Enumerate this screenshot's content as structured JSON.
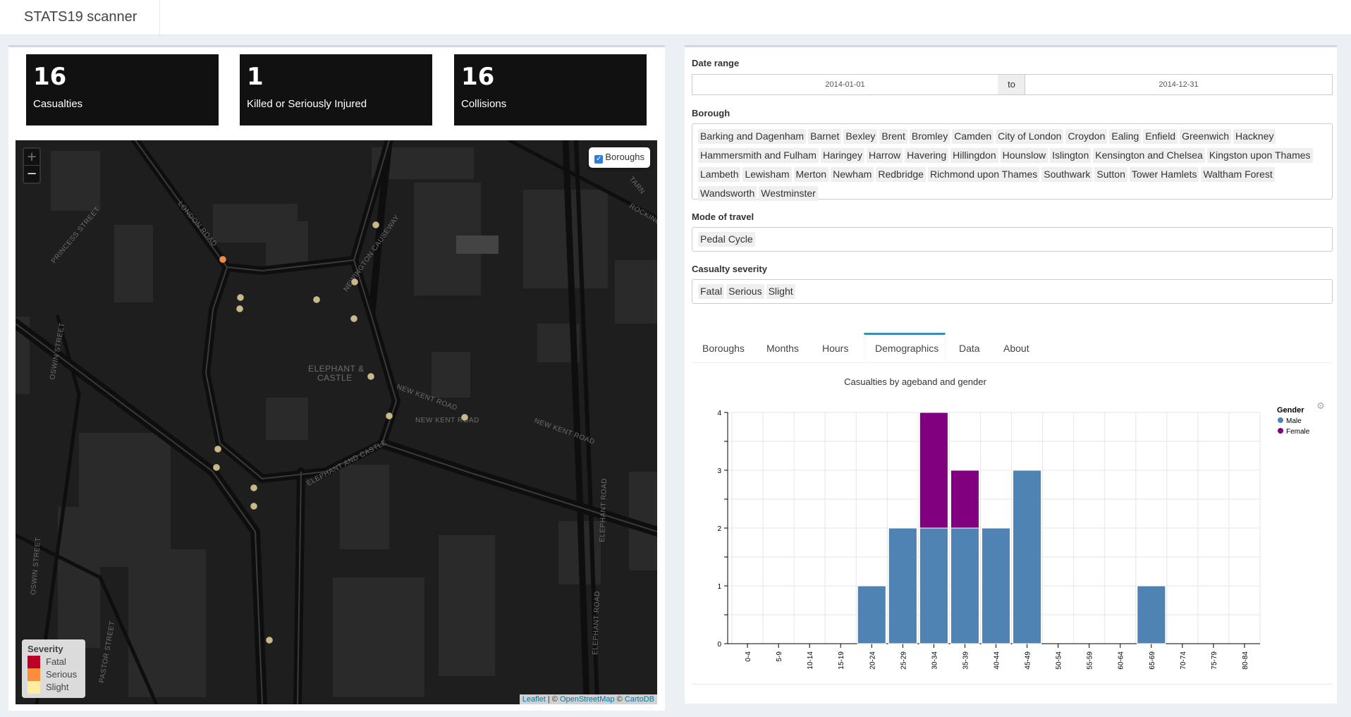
{
  "app": {
    "title": "STATS19 scanner"
  },
  "value_boxes": [
    {
      "value": "16",
      "label": "Casualties"
    },
    {
      "value": "1",
      "label": "Killed or Seriously Injured"
    },
    {
      "value": "16",
      "label": "Collisions"
    }
  ],
  "map": {
    "zoom_in": "+",
    "zoom_out": "−",
    "layers_control": {
      "label": "Boroughs",
      "checked": true
    },
    "labels": [
      "LONDON ROAD",
      "PRINCESS STREET",
      "NEWINGTON CAUSEWAY",
      "ELEPHANT &",
      "CASTLE",
      "NEW KENT ROAD",
      "NEW KENT ROAD",
      "NEW KENT ROAD",
      "ELEPHANT AND CASTLE",
      "ELEPHANT ROAD",
      "ELEPHANT ROAD",
      "OSWIN STREET",
      "OSWIN STREET",
      "PASTOR STREET",
      "TARN",
      "ROCKING"
    ],
    "legend": {
      "title": "Severity",
      "items": [
        {
          "label": "Fatal",
          "color": "#bd0026"
        },
        {
          "label": "Serious",
          "color": "#fd8d3c"
        },
        {
          "label": "Slight",
          "color": "#ffeda0"
        }
      ]
    },
    "attribution": {
      "leaflet": "Leaflet",
      "sep1": " | © ",
      "osm": "OpenStreetMap",
      "sep2": " © ",
      "carto": "CartoDB"
    }
  },
  "filters": {
    "date_range": {
      "label": "Date range",
      "start": "2014-01-01",
      "separator": "to",
      "end": "2014-12-31"
    },
    "borough": {
      "label": "Borough",
      "selected": [
        "Barking and Dagenham",
        "Barnet",
        "Bexley",
        "Brent",
        "Bromley",
        "Camden",
        "City of London",
        "Croydon",
        "Ealing",
        "Enfield",
        "Greenwich",
        "Hackney",
        "Hammersmith and Fulham",
        "Haringey",
        "Harrow",
        "Havering",
        "Hillingdon",
        "Hounslow",
        "Islington",
        "Kensington and Chelsea",
        "Kingston upon Thames",
        "Lambeth",
        "Lewisham",
        "Merton",
        "Newham",
        "Redbridge",
        "Richmond upon Thames",
        "Southwark",
        "Sutton",
        "Tower Hamlets",
        "Waltham Forest",
        "Wandsworth",
        "Westminster"
      ]
    },
    "mode": {
      "label": "Mode of travel",
      "selected": [
        "Pedal Cycle"
      ]
    },
    "severity": {
      "label": "Casualty severity",
      "selected": [
        "Fatal",
        "Serious",
        "Slight"
      ]
    }
  },
  "tabs": [
    {
      "label": "Boroughs",
      "active": false
    },
    {
      "label": "Months",
      "active": false
    },
    {
      "label": "Hours",
      "active": false
    },
    {
      "label": "Demographics",
      "active": true
    },
    {
      "label": "Data",
      "active": false
    },
    {
      "label": "About",
      "active": false
    }
  ],
  "chart_data": {
    "type": "bar",
    "stacked": true,
    "title": "Casualties by ageband and gender",
    "xlabel": "",
    "ylabel": "",
    "categories": [
      "0-4",
      "5-9",
      "10-14",
      "15-19",
      "20-24",
      "25-29",
      "30-34",
      "35-39",
      "40-44",
      "45-49",
      "50-54",
      "55-59",
      "60-64",
      "65-69",
      "70-74",
      "75-79",
      "80-84"
    ],
    "series": [
      {
        "name": "Male",
        "color": "#4f83b4",
        "values": [
          0,
          0,
          0,
          0,
          1,
          2,
          2,
          2,
          2,
          3,
          0,
          0,
          0,
          1,
          0,
          0,
          0
        ]
      },
      {
        "name": "Female",
        "color": "#800080",
        "values": [
          0,
          0,
          0,
          0,
          0,
          0,
          2,
          1,
          0,
          0,
          0,
          0,
          0,
          0,
          0,
          0,
          0
        ]
      }
    ],
    "yticks": [
      0,
      1,
      2,
      3,
      4
    ],
    "ylim": [
      0,
      4
    ],
    "legend": {
      "title": "Gender",
      "position": "top-right"
    },
    "grid": true
  }
}
